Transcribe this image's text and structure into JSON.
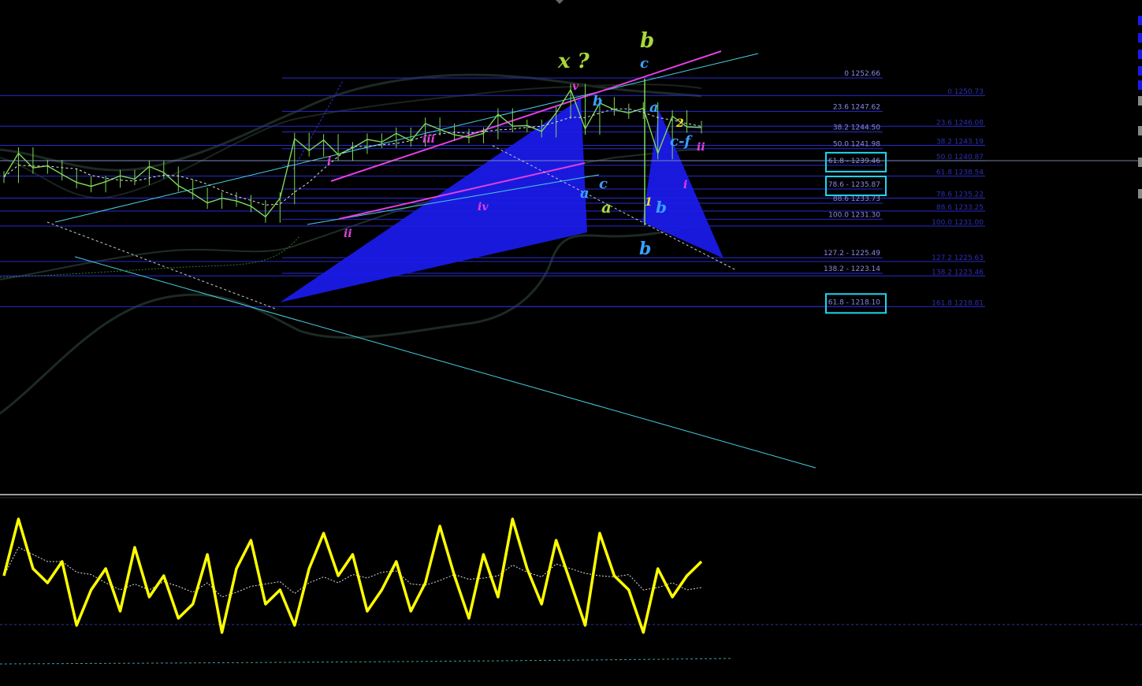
{
  "colors": {
    "background": "#000000",
    "fib_line": "#2a2acf",
    "fib_label_primary": "#8a8ae6",
    "fib_label_secondary": "#2e2eb0",
    "highlight_box": "#22d3ee",
    "candles": "#7ed957",
    "channel": "#48d1e0",
    "trend_magenta": "#e040e0",
    "harmonic_fill": "#1a1ae8",
    "envelope": "#1c2a22",
    "oscillator": "#ffff00",
    "separator": "#d0d0d0"
  },
  "fib_primary": [
    {
      "label": "0 1252.66",
      "price": 1252.66
    },
    {
      "label": "23.6 1247.62",
      "price": 1247.62
    },
    {
      "label": "38.2 1244.50",
      "price": 1244.5
    },
    {
      "label": "50.0 1241.98",
      "price": 1241.98
    },
    {
      "label": "61.8 - 1239.46",
      "price": 1239.46,
      "boxed": true
    },
    {
      "label": "78.6 - 1235.87",
      "price": 1235.87,
      "boxed": true
    },
    {
      "label": "88.6 1233.73",
      "price": 1233.73
    },
    {
      "label": "100.0 1231.30",
      "price": 1231.3
    },
    {
      "label": "127.2 - 1225.49",
      "price": 1225.49
    },
    {
      "label": "138.2 - 1223.14",
      "price": 1223.14
    },
    {
      "label": "61.8 - 1218.10",
      "price": 1218.1,
      "boxed": true
    }
  ],
  "fib_secondary": [
    {
      "label": "0 1250.73",
      "price": 1250.73
    },
    {
      "label": "23.6 1246.08",
      "price": 1246.08
    },
    {
      "label": "38.2 1243.19",
      "price": 1243.19
    },
    {
      "label": "50.0 1240.87",
      "price": 1240.87
    },
    {
      "label": "61.8 1238.54",
      "price": 1238.54
    },
    {
      "label": "78.6 1235.22",
      "price": 1235.22
    },
    {
      "label": "88.6 1233.25",
      "price": 1233.25
    },
    {
      "label": "100.0 1231.00",
      "price": 1231.0
    },
    {
      "label": "127.2 1225.63",
      "price": 1225.63
    },
    {
      "label": "138.2 1223.46",
      "price": 1223.46
    },
    {
      "label": "161.8 1218.81",
      "price": 1218.81
    }
  ],
  "chart_data": [
    {
      "type": "line",
      "series": [
        {
          "values": [
            1237.2,
            1240.8,
            1238.6,
            1238.9,
            1237.6,
            1236.4,
            1235.8,
            1236.5,
            1237.4,
            1236.9,
            1238.8,
            1237.9,
            1235.9,
            1234.7,
            1233.3,
            1234.0,
            1233.6,
            1232.8,
            1231.2,
            1234.0,
            1243.0,
            1241.2,
            1242.8,
            1240.6,
            1241.6,
            1242.9,
            1242.5,
            1243.8,
            1242.7,
            1245.3,
            1244.4,
            1243.6,
            1243.2,
            1243.8,
            1246.7,
            1244.9,
            1245.0,
            1244.1,
            1246.9,
            1250.4,
            1244.5,
            1248.4,
            1247.4,
            1246.9,
            1247.6,
            1240.8,
            1246.4,
            1244.8,
            1244.7
          ]
        }
      ]
    },
    {
      "type": "line",
      "series": [
        {
          "values": [
            55,
            95,
            60,
            50,
            65,
            20,
            45,
            60,
            30,
            75,
            40,
            55,
            25,
            35,
            70,
            15,
            60,
            80,
            35,
            45,
            20,
            60,
            85,
            55,
            70,
            30,
            45,
            65,
            30,
            50,
            90,
            55,
            25,
            70,
            40,
            95,
            60,
            35,
            80,
            50,
            20,
            85,
            55,
            45,
            15,
            60,
            40,
            55,
            65
          ]
        }
      ]
    }
  ],
  "annotations": {
    "x_question": "x ?",
    "b_top": "b",
    "c_top": "c",
    "v": "v",
    "b_blue_1": "b",
    "a_blue_1": "a",
    "iii": "iii",
    "i_left": "i",
    "ii_left": "ii",
    "iv": "iv",
    "a_blue_2": "a",
    "c_blue": "c",
    "a_green": "a",
    "one": "1",
    "b_blue_2": "b",
    "b_bottom": "b",
    "two": "2",
    "cf": "c-f",
    "ii_right": "ii",
    "i_right": "i"
  }
}
